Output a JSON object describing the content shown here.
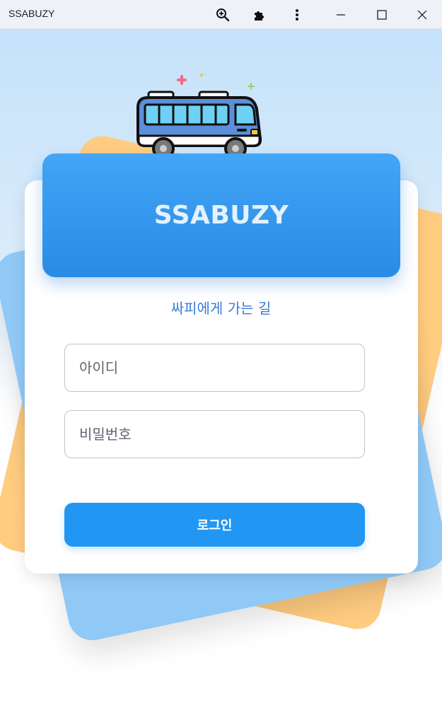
{
  "window": {
    "title": "SSABUZY",
    "controls": {
      "zoom_icon": "zoom-in-icon",
      "extensions_icon": "puzzle-icon",
      "menu_icon": "kebab-menu-icon",
      "minimize_icon": "minimize-icon",
      "maximize_icon": "maximize-icon",
      "close_icon": "close-icon"
    }
  },
  "app": {
    "logo_icon": "bus-icon",
    "title": "SSABUZY",
    "subtitle": "싸피에게 가는 길",
    "form": {
      "id_placeholder": "아이디",
      "password_placeholder": "비밀번호",
      "login_label": "로그인"
    }
  },
  "colors": {
    "header_blue": "#2a8be6",
    "button_blue": "#2196f3",
    "subtitle_blue": "#3a7bd5",
    "orange_card": "#ffcc80",
    "blue_card": "#90c8f6"
  }
}
